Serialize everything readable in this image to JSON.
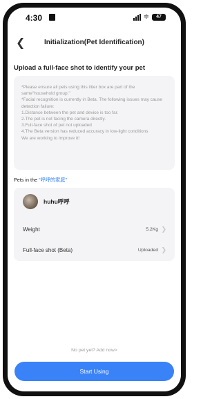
{
  "status": {
    "time": "4:30",
    "battery": "47"
  },
  "nav": {
    "back_icon": "chevron-left",
    "title": "Initialization(Pet Identification)"
  },
  "upload": {
    "heading": "Upload a full-face shot to identify your pet",
    "notes": [
      "*Please ensure all pets using this litter box are part of the same\"household group.\"",
      "*Facial recognition is currently in Beta. The following issues may cause detection failure:",
      "1.Distance between the pet and device is too far.",
      "2.The pet is not facing the camera directly.",
      "3.Full-face shot of pet not uploaded",
      "4.The Beta version has reduced accuracy in low-light conditions",
      "We are working to improve it!"
    ]
  },
  "pets": {
    "label_prefix": "Pets in the ",
    "household_name": "\"呼呼的家庭\"",
    "pet": {
      "name": "huhu呼呼",
      "weight_label": "Weight",
      "weight_value": "5.2Kg",
      "shot_label": "Full-face shot (Beta)",
      "shot_value": "Uploaded"
    }
  },
  "footer": {
    "add_link": "No pet yet? Add now>",
    "start_button": "Start Using"
  },
  "colors": {
    "accent": "#3a82f7",
    "link": "#2f7cf6",
    "card_bg": "#f4f4f6"
  }
}
